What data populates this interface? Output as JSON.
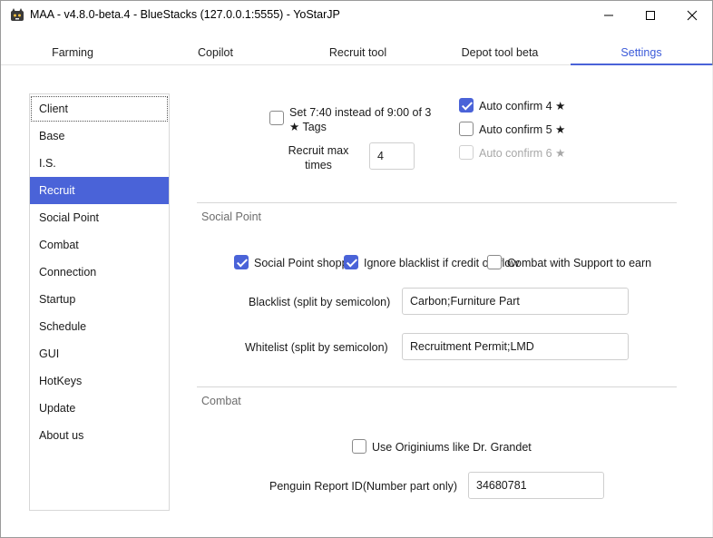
{
  "window": {
    "title": "MAA - v4.8.0-beta.4 - BlueStacks (127.0.0.1:5555) - YoStarJP",
    "app_icon": "maa-logo-icon",
    "controls": [
      "minimize-icon",
      "maximize-icon",
      "close-icon"
    ]
  },
  "tabs": [
    {
      "label": "Farming"
    },
    {
      "label": "Copilot"
    },
    {
      "label": "Recruit tool"
    },
    {
      "label": "Depot tool beta"
    },
    {
      "label": "Settings",
      "active": true
    }
  ],
  "sidebar": {
    "items": [
      {
        "label": "Client"
      },
      {
        "label": "Base"
      },
      {
        "label": "I.S."
      },
      {
        "label": "Recruit"
      },
      {
        "label": "Social Point"
      },
      {
        "label": "Combat"
      },
      {
        "label": "Connection"
      },
      {
        "label": "Startup"
      },
      {
        "label": "Schedule"
      },
      {
        "label": "GUI"
      },
      {
        "label": "HotKeys"
      },
      {
        "label": "Update"
      },
      {
        "label": "About us"
      }
    ],
    "selected": "Recruit",
    "focused": "Client"
  },
  "recruit": {
    "set_740_label": "Set 7:40 instead of 9:00 of 3 ★ Tags",
    "set_740_checked": false,
    "max_times_label": "Recruit max times",
    "max_times_value": "4",
    "auto_confirm": [
      {
        "label": "Auto confirm 4 ★",
        "checked": true,
        "disabled": false
      },
      {
        "label": "Auto confirm 5 ★",
        "checked": false,
        "disabled": false
      },
      {
        "label": "Auto confirm 6 ★",
        "checked": false,
        "disabled": true
      }
    ]
  },
  "social_point": {
    "section_title": "Social Point",
    "shopping_label": "Social Point shopp",
    "shopping_checked": true,
    "ignore_blacklist_label": "Ignore blacklist if credit ov",
    "ignore_blacklist_suffix": "flow",
    "ignore_blacklist_checked": true,
    "combat_support_label": "Combat with Support to earn",
    "combat_support_checked": false,
    "blacklist_label": "Blacklist (split by semicolon)",
    "blacklist_value": "Carbon;Furniture Part",
    "whitelist_label": "Whitelist (split by semicolon)",
    "whitelist_value": "Recruitment Permit;LMD"
  },
  "combat": {
    "section_title": "Combat",
    "originiums_label": "Use Originiums like Dr. Grandet",
    "originiums_checked": false,
    "penguin_label": "Penguin Report ID(Number part only)",
    "penguin_value": "34680781"
  },
  "colors": {
    "accent": "#4a63d8",
    "selected_text": "#ffffff",
    "section_title": "#6d6d6d",
    "disabled_text": "#a8a8a8"
  }
}
